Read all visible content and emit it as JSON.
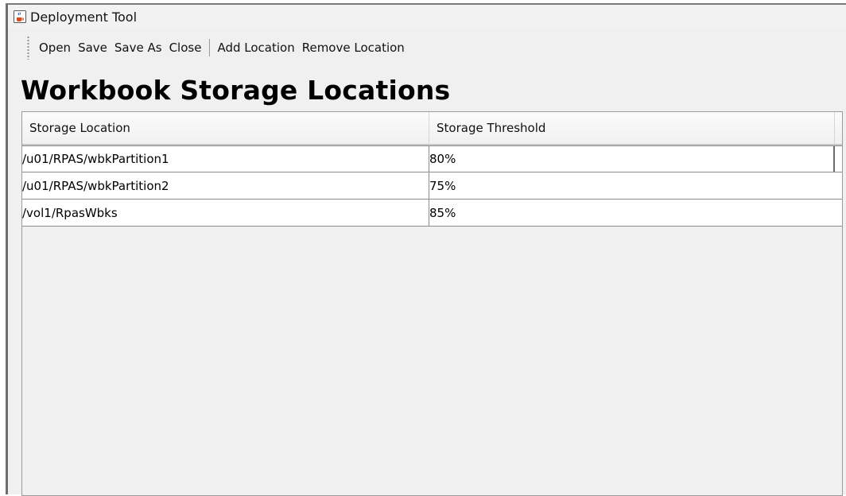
{
  "window": {
    "title": "Deployment Tool"
  },
  "toolbar": {
    "items": [
      {
        "label": "Open"
      },
      {
        "label": "Save"
      },
      {
        "label": "Save As"
      },
      {
        "label": "Close"
      },
      {
        "label": "Add Location"
      },
      {
        "label": "Remove Location"
      }
    ]
  },
  "page": {
    "title": "Workbook Storage Locations"
  },
  "table": {
    "headers": [
      "Storage Location",
      "Storage Threshold"
    ],
    "rows": [
      [
        "/u01/RPAS/wbkPartition1",
        "80%"
      ],
      [
        "/u01/RPAS/wbkPartition2",
        "75%"
      ],
      [
        "/vol1/RpasWbks",
        "85%"
      ]
    ]
  },
  "icons": {
    "app": "java-cup-icon",
    "toolbar_grip": "grip-icon"
  }
}
